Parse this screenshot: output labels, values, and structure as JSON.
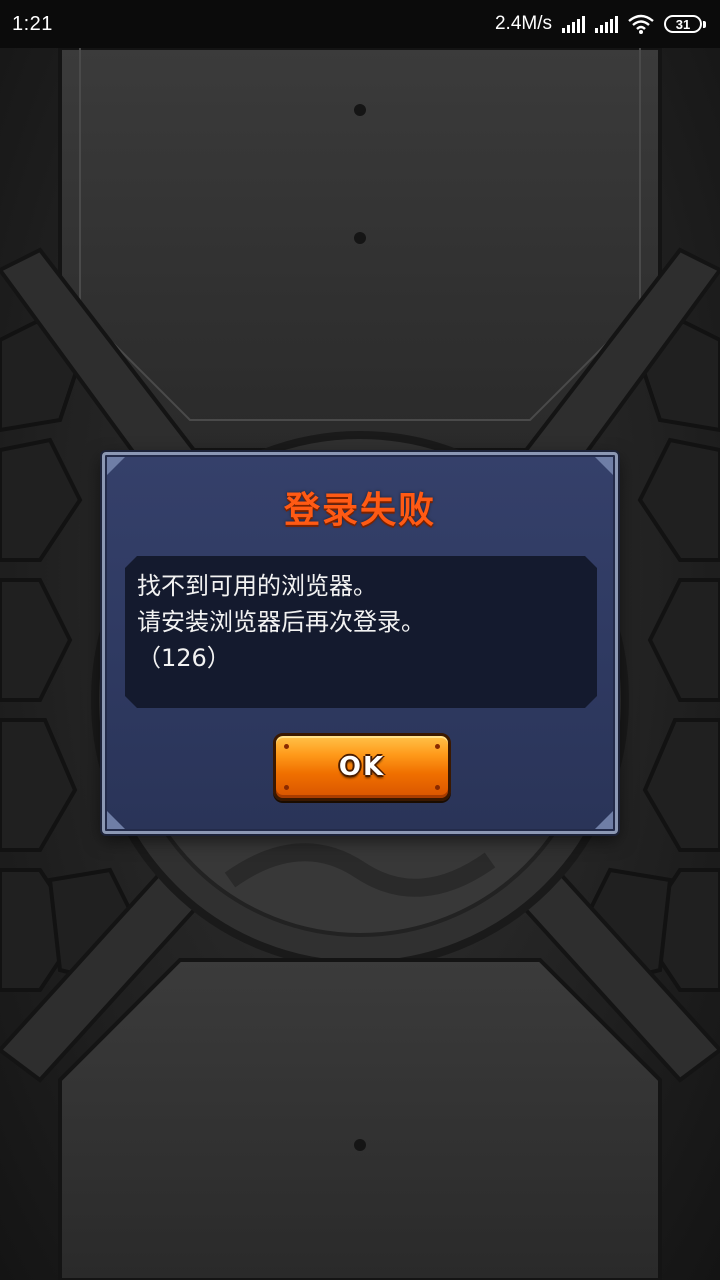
{
  "status_bar": {
    "time": "1:21",
    "net_speed": "2.4M/s",
    "battery_level": "31",
    "icons": [
      "signal-icon",
      "signal-icon",
      "wifi-icon",
      "battery-icon"
    ]
  },
  "dialog": {
    "title": "登录失败",
    "message_lines": [
      "找不到可用的浏览器。",
      "请安装浏览器后再次登录。",
      "（126）"
    ],
    "ok_label": "OK"
  },
  "colors": {
    "title": "#ff5a14",
    "dialog_bg": "#2f3a62",
    "button": "#f07000"
  }
}
